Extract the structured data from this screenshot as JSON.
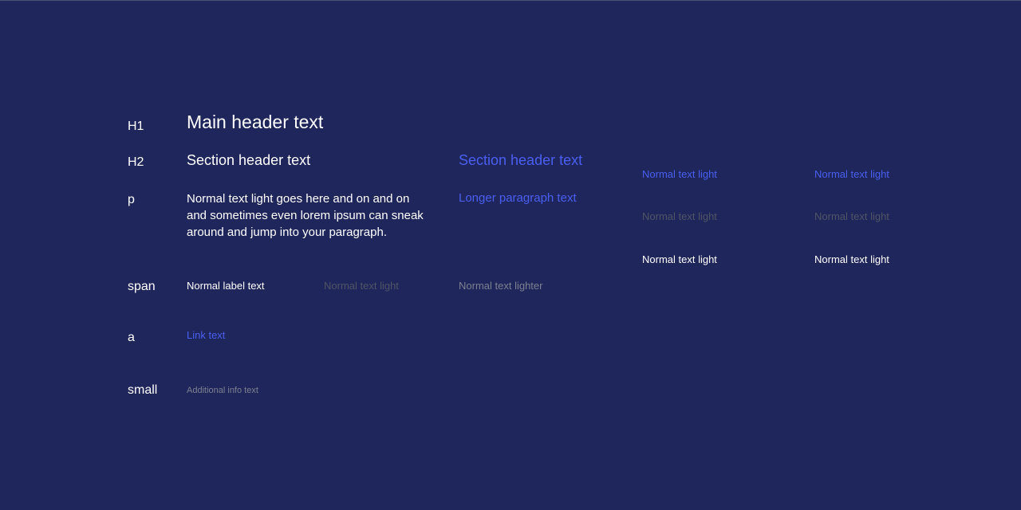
{
  "colors": {
    "background": "#1f265b",
    "text_primary": "#ffffff",
    "accent": "#4a5ff1",
    "text_muted": "#4f5565",
    "text_lighter": "#7c8190"
  },
  "row_labels": {
    "h1": "H1",
    "h2": "H2",
    "p": "p",
    "span": "span",
    "a": "a",
    "small": "small"
  },
  "h1": {
    "main": "Main header text"
  },
  "h2": {
    "main": "Section header text",
    "accent": "Section header text"
  },
  "paragraph": {
    "main": "Normal text light goes here and on and on and sometimes even lorem ipsum can sneak around and jump into your paragraph.",
    "accent": "Longer paragraph text"
  },
  "span": {
    "label": "Normal label text",
    "light": "Normal text light",
    "lighter": "Normal text lighter"
  },
  "link": {
    "text": "Link text"
  },
  "small": {
    "info": "Additional info text"
  },
  "swatches": {
    "row1": [
      "Normal text light",
      "Normal text light"
    ],
    "row2": [
      "Normal text light",
      "Normal text light"
    ],
    "row3": [
      "Normal text light",
      "Normal text light"
    ]
  }
}
